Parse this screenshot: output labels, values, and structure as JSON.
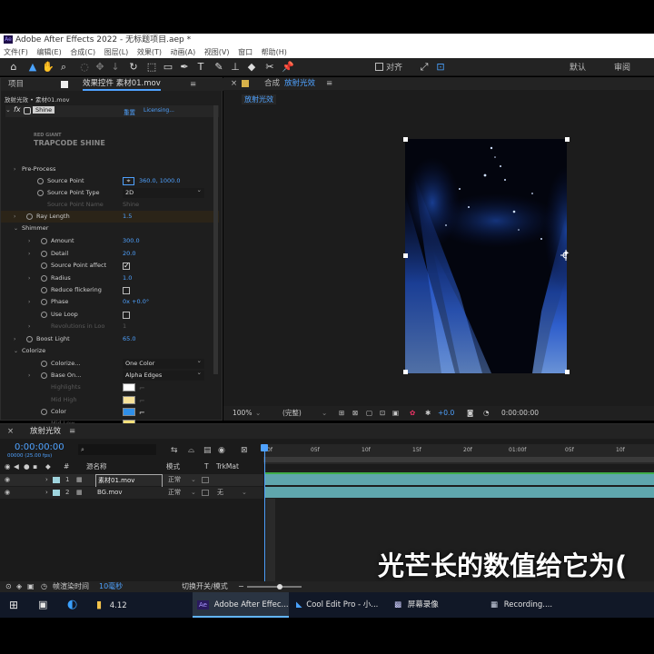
{
  "app": {
    "title": "Adobe After Effects 2022 - 无标题项目.aep *",
    "logo": "Ae"
  },
  "menu": [
    "文件(F)",
    "编辑(E)",
    "合成(C)",
    "图层(L)",
    "效果(T)",
    "动画(A)",
    "视图(V)",
    "窗口",
    "帮助(H)"
  ],
  "toolbar": {
    "tools": [
      "home-icon",
      "selection-icon",
      "hand-icon",
      "zoom-icon",
      "orbit-icon",
      "track-xy-icon",
      "dolly-icon",
      "rotate-icon",
      "rectangle-icon",
      "pen-icon",
      "type-icon",
      "brush-icon",
      "clone-stamp-icon",
      "eraser-icon",
      "roto-brush-icon",
      "puppet-pin-icon"
    ],
    "snap_label": "对齐",
    "workspaces": [
      "默认",
      "审阅"
    ]
  },
  "project_panel": {
    "tab_project": "项目",
    "tab_effects": "效果控件 素材01.mov",
    "breadcrumb": "放射光效 • 素材01.mov",
    "effect_name": "Shine",
    "reset_label": "重置",
    "licensing_label": "Licensing...",
    "plugin_brand_line1": "RED GIANT",
    "plugin_brand_line2": "TRAPCODE SHINE",
    "properties": [
      {
        "label": "Pre-Process",
        "indent": 1,
        "caret": "›",
        "value": ""
      },
      {
        "label": "Source Point",
        "indent": 2,
        "stopwatch": true,
        "value": "360.0, 1000.0",
        "target": true
      },
      {
        "label": "Source Point Type",
        "indent": 2,
        "stopwatch": true,
        "dropdown": "2D"
      },
      {
        "label": "Source Point Name",
        "indent": 2,
        "dim": true,
        "value": "Shine"
      },
      {
        "label": "Ray Length",
        "indent": 1,
        "caret": "›",
        "stopwatch": true,
        "value": "1.5",
        "highlight": true
      },
      {
        "label": "Shimmer",
        "indent": 1,
        "caret": "⌄",
        "value": ""
      },
      {
        "label": "Amount",
        "indent": 3,
        "caret": "›",
        "stopwatch": true,
        "value": "300.0"
      },
      {
        "label": "Detail",
        "indent": 3,
        "caret": "›",
        "stopwatch": true,
        "value": "20.0"
      },
      {
        "label": "Source Point affect",
        "indent": 3,
        "stopwatch": true,
        "checkbox": true
      },
      {
        "label": "Radius",
        "indent": 3,
        "caret": "›",
        "stopwatch": true,
        "value": "1.0"
      },
      {
        "label": "Reduce flickering",
        "indent": 3,
        "stopwatch": true,
        "checkbox": false
      },
      {
        "label": "Phase",
        "indent": 3,
        "caret": "›",
        "stopwatch": true,
        "value": "0x +0.0°"
      },
      {
        "label": "Use Loop",
        "indent": 3,
        "stopwatch": true,
        "checkbox": false
      },
      {
        "label": "Revolutions in Loo",
        "indent": 3,
        "caret": "›",
        "dim": true,
        "value": "1"
      },
      {
        "label": "Boost Light",
        "indent": 1,
        "caret": "›",
        "stopwatch": true,
        "value": "65.0"
      },
      {
        "label": "Colorize",
        "indent": 1,
        "caret": "⌄",
        "value": ""
      },
      {
        "label": "Colorize...",
        "indent": 3,
        "stopwatch": true,
        "dropdown": "One Color"
      },
      {
        "label": "Base On...",
        "indent": 3,
        "caret": "›",
        "stopwatch": true,
        "dropdown": "Alpha Edges"
      },
      {
        "label": "Highlights",
        "indent": 3,
        "dim": true,
        "swatch": "#ffffff"
      },
      {
        "label": "Mid High",
        "indent": 3,
        "dim": true,
        "swatch": "#f7e29a"
      },
      {
        "label": "Color",
        "indent": 3,
        "stopwatch": true,
        "swatch": "#2f8fe8"
      },
      {
        "label": "Mid Low",
        "indent": 3,
        "dim": true,
        "swatch": "#f5e07a"
      }
    ]
  },
  "comp_panel": {
    "lock_label": "合成",
    "comp_name": "放射光效",
    "flow_tab": "放射光效",
    "zoom": "100%",
    "resolution": "(完整)",
    "exposure": "+0.0",
    "timecode": "0:00:00:00"
  },
  "timeline": {
    "comp_tab": "放射光效",
    "timecode": "0:00:00:00",
    "timecode_sub": "00000 (25.00 fps)",
    "columns": {
      "source_name": "源名称",
      "mode": "模式",
      "t": "T",
      "trkmat": "TrkMat"
    },
    "layers": [
      {
        "index": "1",
        "name": "素材01.mov",
        "mode": "正常",
        "trkmat": ""
      },
      {
        "index": "2",
        "name": "BG.mov",
        "mode": "正常",
        "trkmat": "无"
      }
    ],
    "ruler": [
      "0f",
      "05f",
      "10f",
      "15f",
      "20f",
      "01:00f",
      "05f",
      "10f"
    ],
    "render_label": "帧渲染时间",
    "render_value": "10毫秒",
    "switch_label": "切换开关/模式"
  },
  "subtitle": "光芒长的数值给它为(",
  "taskbar": {
    "items": [
      {
        "label": "4.12",
        "icon": "folder-icon"
      },
      {
        "label": "Adobe After Effec...",
        "icon": "ae-icon",
        "active": true
      },
      {
        "label": "Cool Edit Pro  - 小...",
        "icon": "cool-edit-icon"
      },
      {
        "label": "屏幕录像",
        "icon": "recorder-icon"
      },
      {
        "label": "Recording....",
        "icon": "recording-icon"
      }
    ]
  },
  "colors": {
    "accent": "#4fa2ff",
    "timeline_bar": "#5fa6ad",
    "panel_bg": "#1e1e1e"
  }
}
